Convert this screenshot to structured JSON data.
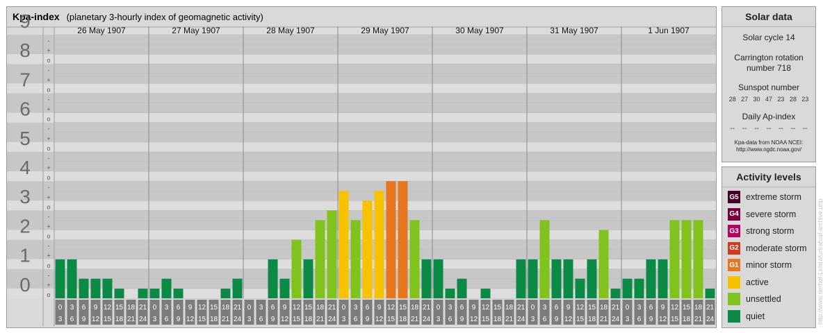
{
  "header": {
    "title": "Kpa-index",
    "subtitle": "(planetary 3-hourly index of geomagnetic activity)"
  },
  "chart_data": {
    "type": "bar",
    "days": [
      "26 May 1907",
      "27 May 1907",
      "28 May 1907",
      "29 May 1907",
      "30 May 1907",
      "31 May 1907",
      "1 Jun 1907"
    ],
    "intervals_top": [
      "0",
      "3",
      "6",
      "9",
      "12",
      "15",
      "18",
      "21"
    ],
    "intervals_bottom": [
      "3",
      "6",
      "9",
      "12",
      "15",
      "18",
      "21",
      "24"
    ],
    "y_ticks": [
      "0",
      "1",
      "2",
      "3",
      "4",
      "5",
      "6",
      "7",
      "8",
      "9"
    ],
    "minor_labels": [
      "o",
      "+",
      "-"
    ],
    "ylim": [
      0,
      9
    ],
    "values": [
      1.33,
      1.33,
      0.67,
      0.67,
      0.67,
      0.33,
      0,
      0.33,
      0.33,
      0.67,
      0.33,
      0,
      0,
      0,
      0.33,
      0.67,
      0,
      0,
      1.33,
      0.67,
      2,
      1.33,
      2.67,
      3,
      3.67,
      2.67,
      3.33,
      3.67,
      4,
      4,
      2.67,
      1.33,
      1.33,
      0.33,
      0.67,
      0,
      0.33,
      0,
      0,
      1.33,
      1.33,
      2.67,
      1.33,
      1.33,
      0.67,
      1.33,
      2.33,
      0.33,
      0.67,
      0.67,
      1.33,
      1.33,
      2.67,
      2.67,
      2.67,
      0.33
    ],
    "categories": [
      "quiet",
      "quiet",
      "quiet",
      "quiet",
      "quiet",
      "quiet",
      "quiet",
      "quiet",
      "quiet",
      "quiet",
      "quiet",
      "quiet",
      "quiet",
      "quiet",
      "quiet",
      "quiet",
      "quiet",
      "quiet",
      "quiet",
      "quiet",
      "unsettled",
      "quiet",
      "unsettled",
      "unsettled",
      "active",
      "unsettled",
      "active",
      "active",
      "G1",
      "G1",
      "unsettled",
      "quiet",
      "quiet",
      "quiet",
      "quiet",
      "quiet",
      "quiet",
      "quiet",
      "quiet",
      "quiet",
      "quiet",
      "unsettled",
      "quiet",
      "quiet",
      "quiet",
      "quiet",
      "unsettled",
      "quiet",
      "quiet",
      "quiet",
      "quiet",
      "quiet",
      "unsettled",
      "unsettled",
      "unsettled",
      "quiet"
    ]
  },
  "solar": {
    "heading": "Solar data",
    "cycle": "Solar cycle 14",
    "carrington_line1": "Carrington rotation",
    "carrington_line2": "number 718",
    "sunspot_label": "Sunspot number",
    "sunspot_values": [
      "28",
      "27",
      "30",
      "47",
      "23",
      "28",
      "23"
    ],
    "ap_label": "Daily Ap-index",
    "ap_values": [
      "--",
      "--",
      "--",
      "--",
      "--",
      "--",
      "--"
    ],
    "source_line1": "Kpa-data from NOAA NCEI:",
    "source_line2": "http://www.ngdc.noaa.gov/"
  },
  "activity": {
    "heading": "Activity levels",
    "levels": [
      {
        "badge": "G5",
        "label": "extreme storm",
        "color": "#4d0026"
      },
      {
        "badge": "G4",
        "label": "severe storm",
        "color": "#7a0041"
      },
      {
        "badge": "G3",
        "label": "strong storm",
        "color": "#b5005e"
      },
      {
        "badge": "G2",
        "label": "moderate storm",
        "color": "#d13a1a"
      },
      {
        "badge": "G1",
        "label": "minor storm",
        "color": "#e6771e"
      },
      {
        "badge": "",
        "label": "active",
        "color": "#f7c200"
      },
      {
        "badge": "",
        "label": "unsettled",
        "color": "#7fc31c"
      },
      {
        "badge": "",
        "label": "quiet",
        "color": "#0a8a44"
      }
    ]
  },
  "colors": {
    "quiet": "#0a8a44",
    "unsettled": "#7fc31c",
    "active": "#f7c200",
    "G1": "#e6771e",
    "band_dark": "#c7c7c7",
    "band_light": "#dddddd",
    "cell": "#7c7c7c"
  },
  "watermark": "http://www.tierhof-Lelitrafurtrafuaf.archive.php"
}
